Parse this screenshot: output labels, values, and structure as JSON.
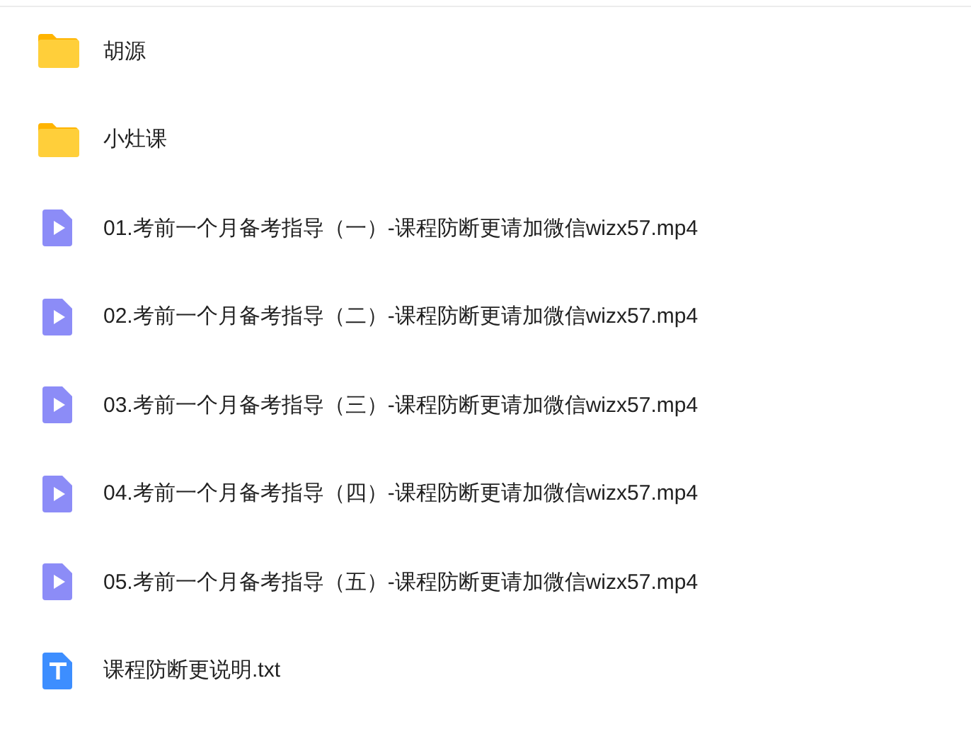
{
  "files": [
    {
      "kind": "folder",
      "name": "胡源"
    },
    {
      "kind": "folder",
      "name": "小灶课"
    },
    {
      "kind": "video",
      "name": "01.考前一个月备考指导（一）-课程防断更请加微信wizx57.mp4"
    },
    {
      "kind": "video",
      "name": "02.考前一个月备考指导（二）-课程防断更请加微信wizx57.mp4"
    },
    {
      "kind": "video",
      "name": "03.考前一个月备考指导（三）-课程防断更请加微信wizx57.mp4"
    },
    {
      "kind": "video",
      "name": "04.考前一个月备考指导（四）-课程防断更请加微信wizx57.mp4"
    },
    {
      "kind": "video",
      "name": "05.考前一个月备考指导（五）-课程防断更请加微信wizx57.mp4"
    },
    {
      "kind": "text",
      "name": "课程防断更说明.txt"
    }
  ]
}
